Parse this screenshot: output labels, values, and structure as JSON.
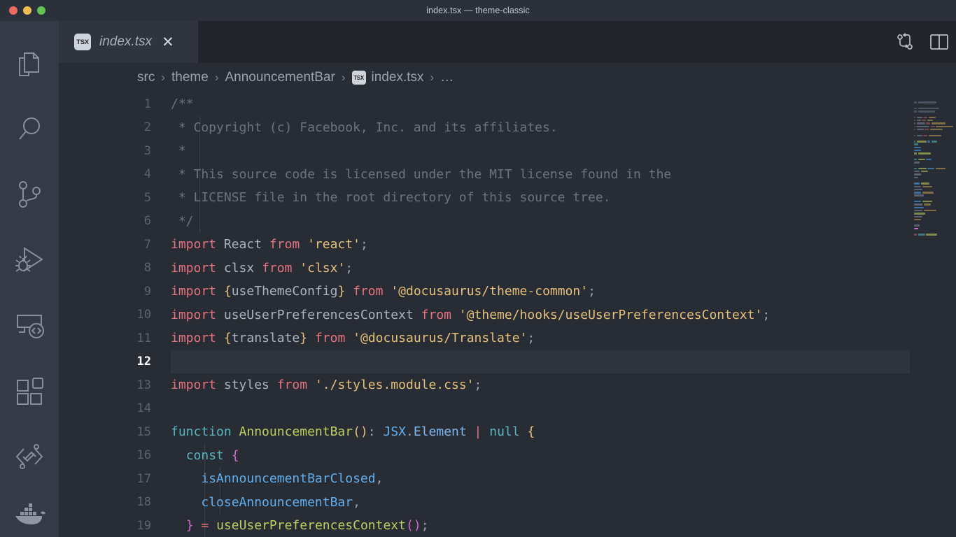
{
  "window": {
    "title": "index.tsx — theme-classic",
    "traffic_lights": [
      "close",
      "minimize",
      "zoom"
    ]
  },
  "activity_bar": {
    "items": [
      {
        "name": "explorer",
        "icon": "files-icon",
        "label": "Explorer"
      },
      {
        "name": "search",
        "icon": "search-icon",
        "label": "Search"
      },
      {
        "name": "source-control",
        "icon": "source-control-icon",
        "label": "Source Control"
      },
      {
        "name": "run-debug",
        "icon": "run-and-debug-icon",
        "label": "Run and Debug"
      },
      {
        "name": "remote-explorer",
        "icon": "remote-explorer-icon",
        "label": "Remote Explorer"
      },
      {
        "name": "extensions",
        "icon": "extensions-icon",
        "label": "Extensions"
      },
      {
        "name": "gitlens",
        "icon": "gitlens-icon",
        "label": "GitLens"
      },
      {
        "name": "docker",
        "icon": "docker-whale-icon",
        "label": "Docker"
      }
    ]
  },
  "tab_bar": {
    "tabs": [
      {
        "label": "index.tsx",
        "icon_text": "TSX",
        "preview": true,
        "active": true,
        "close_glyph": "✕"
      }
    ],
    "actions": [
      {
        "name": "compare-changes",
        "icon": "compare-changes-icon"
      },
      {
        "name": "split-editor",
        "icon": "split-editor-icon"
      }
    ]
  },
  "breadcrumb": {
    "separator": "›",
    "items": [
      {
        "label": "src",
        "icon": null
      },
      {
        "label": "theme",
        "icon": null
      },
      {
        "label": "AnnouncementBar",
        "icon": null
      },
      {
        "label": "index.tsx",
        "icon": "TSX"
      },
      {
        "label": "…",
        "icon": null
      }
    ]
  },
  "editor": {
    "active_line": 12,
    "first_visible_line": 1,
    "lines": [
      {
        "n": 1,
        "tokens": [
          {
            "t": "/**",
            "c": "t-comment"
          }
        ],
        "indent_guides": 0
      },
      {
        "n": 2,
        "tokens": [
          {
            "t": " * Copyright (c) Facebook, Inc. and its affiliates.",
            "c": "t-comment"
          }
        ],
        "indent_guides": 0
      },
      {
        "n": 3,
        "tokens": [
          {
            "t": " *",
            "c": "t-comment"
          }
        ],
        "indent_guides": 0
      },
      {
        "n": 4,
        "tokens": [
          {
            "t": " * This source code is licensed under the MIT license found in the",
            "c": "t-comment"
          }
        ],
        "indent_guides": 0
      },
      {
        "n": 5,
        "tokens": [
          {
            "t": " * LICENSE file in the root directory of this source tree.",
            "c": "t-comment"
          }
        ],
        "indent_guides": 0
      },
      {
        "n": 6,
        "tokens": [
          {
            "t": " */",
            "c": "t-comment"
          }
        ],
        "indent_guides": 0
      },
      {
        "n": 7,
        "tokens": [
          {
            "t": "import",
            "c": "t-key"
          },
          {
            "t": " React ",
            "c": "t-var"
          },
          {
            "t": "from",
            "c": "t-key"
          },
          {
            "t": " ",
            "c": "t-var"
          },
          {
            "t": "'react'",
            "c": "t-str"
          },
          {
            "t": ";",
            "c": "t-punc"
          }
        ],
        "indent_guides": 0
      },
      {
        "n": 8,
        "tokens": [
          {
            "t": "import",
            "c": "t-key"
          },
          {
            "t": " clsx ",
            "c": "t-var"
          },
          {
            "t": "from",
            "c": "t-key"
          },
          {
            "t": " ",
            "c": "t-var"
          },
          {
            "t": "'clsx'",
            "c": "t-str"
          },
          {
            "t": ";",
            "c": "t-punc"
          }
        ],
        "indent_guides": 0
      },
      {
        "n": 9,
        "tokens": [
          {
            "t": "import",
            "c": "t-key"
          },
          {
            "t": " ",
            "c": "t-var"
          },
          {
            "t": "{",
            "c": "t-brace-y"
          },
          {
            "t": "useThemeConfig",
            "c": "t-var"
          },
          {
            "t": "}",
            "c": "t-brace-y"
          },
          {
            "t": " ",
            "c": "t-var"
          },
          {
            "t": "from",
            "c": "t-key"
          },
          {
            "t": " ",
            "c": "t-var"
          },
          {
            "t": "'@docusaurus/theme-common'",
            "c": "t-str"
          },
          {
            "t": ";",
            "c": "t-punc"
          }
        ],
        "indent_guides": 0
      },
      {
        "n": 10,
        "tokens": [
          {
            "t": "import",
            "c": "t-key"
          },
          {
            "t": " useUserPreferencesContext ",
            "c": "t-var"
          },
          {
            "t": "from",
            "c": "t-key"
          },
          {
            "t": " ",
            "c": "t-var"
          },
          {
            "t": "'@theme/hooks/useUserPreferencesContext'",
            "c": "t-str"
          },
          {
            "t": ";",
            "c": "t-punc"
          }
        ],
        "indent_guides": 0
      },
      {
        "n": 11,
        "tokens": [
          {
            "t": "import",
            "c": "t-key"
          },
          {
            "t": " ",
            "c": "t-var"
          },
          {
            "t": "{",
            "c": "t-brace-y"
          },
          {
            "t": "translate",
            "c": "t-var"
          },
          {
            "t": "}",
            "c": "t-brace-y"
          },
          {
            "t": " ",
            "c": "t-var"
          },
          {
            "t": "from",
            "c": "t-key"
          },
          {
            "t": " ",
            "c": "t-var"
          },
          {
            "t": "'@docusaurus/Translate'",
            "c": "t-str"
          },
          {
            "t": ";",
            "c": "t-punc"
          }
        ],
        "indent_guides": 0
      },
      {
        "n": 12,
        "tokens": [],
        "indent_guides": 0
      },
      {
        "n": 13,
        "tokens": [
          {
            "t": "import",
            "c": "t-key"
          },
          {
            "t": " styles ",
            "c": "t-var"
          },
          {
            "t": "from",
            "c": "t-key"
          },
          {
            "t": " ",
            "c": "t-var"
          },
          {
            "t": "'./styles.module.css'",
            "c": "t-str"
          },
          {
            "t": ";",
            "c": "t-punc"
          }
        ],
        "indent_guides": 0
      },
      {
        "n": 14,
        "tokens": [],
        "indent_guides": 0
      },
      {
        "n": 15,
        "tokens": [
          {
            "t": "function",
            "c": "t-kw2"
          },
          {
            "t": " ",
            "c": "t-var"
          },
          {
            "t": "AnnouncementBar",
            "c": "t-fn"
          },
          {
            "t": "()",
            "c": "t-brace-y"
          },
          {
            "t": ":",
            "c": "t-punc"
          },
          {
            "t": " ",
            "c": "t-var"
          },
          {
            "t": "JSX",
            "c": "t-type"
          },
          {
            "t": ".",
            "c": "t-punc"
          },
          {
            "t": "Element",
            "c": "t-type2"
          },
          {
            "t": " ",
            "c": "t-var"
          },
          {
            "t": "|",
            "c": "t-op"
          },
          {
            "t": " ",
            "c": "t-var"
          },
          {
            "t": "null",
            "c": "t-kw2"
          },
          {
            "t": " ",
            "c": "t-var"
          },
          {
            "t": "{",
            "c": "t-brace-y"
          }
        ],
        "indent_guides": 0
      },
      {
        "n": 16,
        "tokens": [
          {
            "t": "  ",
            "c": "t-var"
          },
          {
            "t": "const",
            "c": "t-kw2"
          },
          {
            "t": " ",
            "c": "t-var"
          },
          {
            "t": "{",
            "c": "t-brace-p"
          }
        ],
        "indent_guides": 1
      },
      {
        "n": 17,
        "tokens": [
          {
            "t": "    ",
            "c": "t-var"
          },
          {
            "t": "isAnnouncementBarClosed",
            "c": "t-prop"
          },
          {
            "t": ",",
            "c": "t-punc"
          }
        ],
        "indent_guides": 2
      },
      {
        "n": 18,
        "tokens": [
          {
            "t": "    ",
            "c": "t-var"
          },
          {
            "t": "closeAnnouncementBar",
            "c": "t-prop"
          },
          {
            "t": ",",
            "c": "t-punc"
          }
        ],
        "indent_guides": 2
      },
      {
        "n": 19,
        "tokens": [
          {
            "t": "  ",
            "c": "t-var"
          },
          {
            "t": "}",
            "c": "t-brace-p"
          },
          {
            "t": " ",
            "c": "t-var"
          },
          {
            "t": "=",
            "c": "t-op"
          },
          {
            "t": " ",
            "c": "t-var"
          },
          {
            "t": "useUserPreferencesContext",
            "c": "t-fn"
          },
          {
            "t": "()",
            "c": "t-brace-p"
          },
          {
            "t": ";",
            "c": "t-punc"
          }
        ],
        "indent_guides": 1
      }
    ]
  },
  "minimap": {
    "visible": true,
    "rows": [
      [],
      [
        [
          4,
          "#4a5160"
        ],
        [
          26,
          "#4a5160"
        ]
      ],
      [],
      [
        [
          4,
          "#4a5160"
        ],
        [
          30,
          "#4a5160"
        ]
      ],
      [
        [
          4,
          "#4a5160"
        ],
        [
          24,
          "#4a5160"
        ]
      ],
      [],
      [
        [
          2,
          "#7b4550"
        ],
        [
          8,
          "#5a6070"
        ],
        [
          6,
          "#7b4550"
        ],
        [
          10,
          "#7d6c45"
        ]
      ],
      [
        [
          2,
          "#7b4550"
        ],
        [
          6,
          "#5a6070"
        ],
        [
          6,
          "#7b4550"
        ],
        [
          8,
          "#7d6c45"
        ]
      ],
      [
        [
          2,
          "#7b4550"
        ],
        [
          12,
          "#5a6070"
        ],
        [
          6,
          "#7b4550"
        ],
        [
          20,
          "#7d6c45"
        ]
      ],
      [
        [
          2,
          "#7b4550"
        ],
        [
          20,
          "#5a6070"
        ],
        [
          6,
          "#7b4550"
        ],
        [
          26,
          "#7d6c45"
        ]
      ],
      [
        [
          2,
          "#7b4550"
        ],
        [
          10,
          "#5a6070"
        ],
        [
          6,
          "#7b4550"
        ],
        [
          18,
          "#7d6c45"
        ]
      ],
      [],
      [
        [
          2,
          "#7b4550"
        ],
        [
          8,
          "#5a6070"
        ],
        [
          6,
          "#7b4550"
        ],
        [
          18,
          "#7d6c45"
        ]
      ],
      [],
      [
        [
          2,
          "#3f7a80"
        ],
        [
          14,
          "#7f8a4d"
        ],
        [
          4,
          "#3d6f9c"
        ],
        [
          8,
          "#3f7a80"
        ]
      ],
      [
        [
          6,
          "#3f7a80"
        ]
      ],
      [
        [
          10,
          "#3d6f9c"
        ]
      ],
      [
        [
          10,
          "#3d6f9c"
        ]
      ],
      [
        [
          4,
          "#7f8a4d"
        ],
        [
          18,
          "#7f8a4d"
        ]
      ],
      [],
      [
        [
          4,
          "#3f7a80"
        ],
        [
          10,
          "#7f8a4d"
        ],
        [
          8,
          "#3d6f9c"
        ]
      ],
      [
        [
          8,
          "#5a6070"
        ]
      ],
      [],
      [
        [
          4,
          "#3f7a80"
        ],
        [
          12,
          "#7f8a4d"
        ],
        [
          10,
          "#3d6f9c"
        ],
        [
          14,
          "#7d6c45"
        ]
      ],
      [
        [
          8,
          "#5a6070"
        ],
        [
          10,
          "#7f8a4d"
        ]
      ],
      [
        [
          10,
          "#5a6070"
        ]
      ],
      [
        [
          6,
          "#5a6070"
        ]
      ],
      [],
      [
        [
          8,
          "#3d6f9c"
        ],
        [
          12,
          "#7f8a4d"
        ]
      ],
      [
        [
          10,
          "#5a6070"
        ],
        [
          14,
          "#7d6c45"
        ]
      ],
      [
        [
          12,
          "#5a6070"
        ]
      ],
      [
        [
          10,
          "#3d6f9c"
        ],
        [
          16,
          "#7d6c45"
        ]
      ],
      [
        [
          14,
          "#5a6070"
        ]
      ],
      [],
      [
        [
          10,
          "#3d6f9c"
        ],
        [
          14,
          "#7f8a4d"
        ]
      ],
      [
        [
          12,
          "#5a6070"
        ],
        [
          10,
          "#7d6c45"
        ]
      ],
      [
        [
          14,
          "#3d6f9c"
        ]
      ],
      [
        [
          12,
          "#5a6070"
        ],
        [
          18,
          "#7d6c45"
        ]
      ],
      [
        [
          16,
          "#7f8a4d"
        ]
      ],
      [
        [
          12,
          "#5a6070"
        ]
      ],
      [
        [
          10,
          "#7d6c45"
        ]
      ],
      [],
      [
        [
          8,
          "#5a6070"
        ]
      ],
      [
        [
          6,
          "#d06bd0"
        ]
      ],
      [],
      [
        [
          4,
          "#7b4550"
        ],
        [
          10,
          "#3f7a80"
        ],
        [
          16,
          "#7f8a4d"
        ]
      ]
    ]
  }
}
